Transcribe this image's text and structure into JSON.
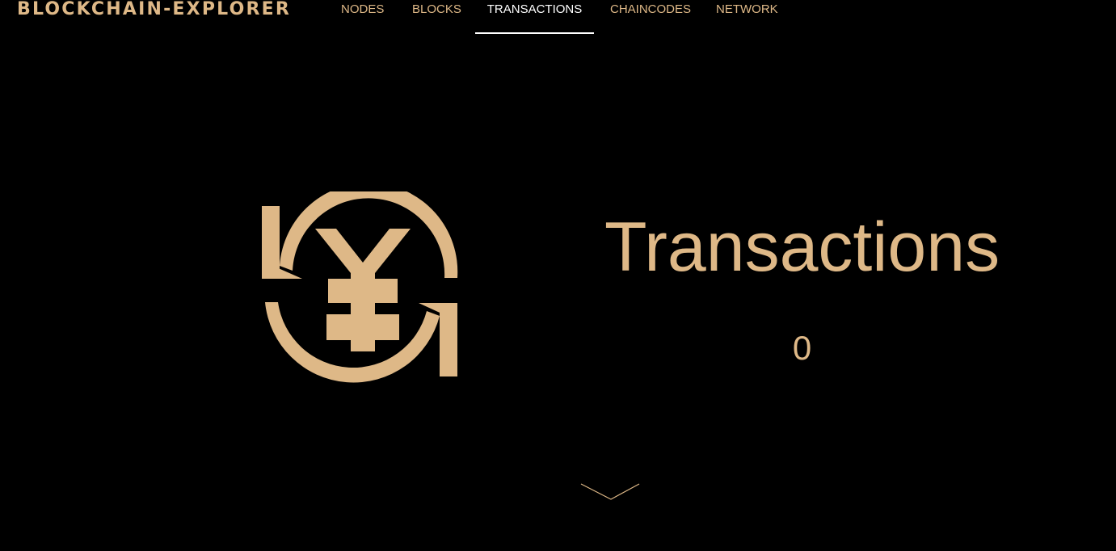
{
  "brand": {
    "title": "BLOCKCHAIN-EXPLORER"
  },
  "nav": {
    "items": [
      {
        "label": "NODES",
        "active": false
      },
      {
        "label": "BLOCKS",
        "active": false
      },
      {
        "label": "TRANSACTIONS",
        "active": true
      },
      {
        "label": "CHAINCODES",
        "active": false
      },
      {
        "label": "NETWORK",
        "active": false
      }
    ]
  },
  "hero": {
    "icon": "yen-exchange-icon",
    "title": "Transactions",
    "count": "0"
  },
  "scroll": {
    "icon": "chevron-down-icon"
  },
  "colors": {
    "background": "#000000",
    "accent": "#DEB887",
    "active": "#FFFFFF"
  }
}
